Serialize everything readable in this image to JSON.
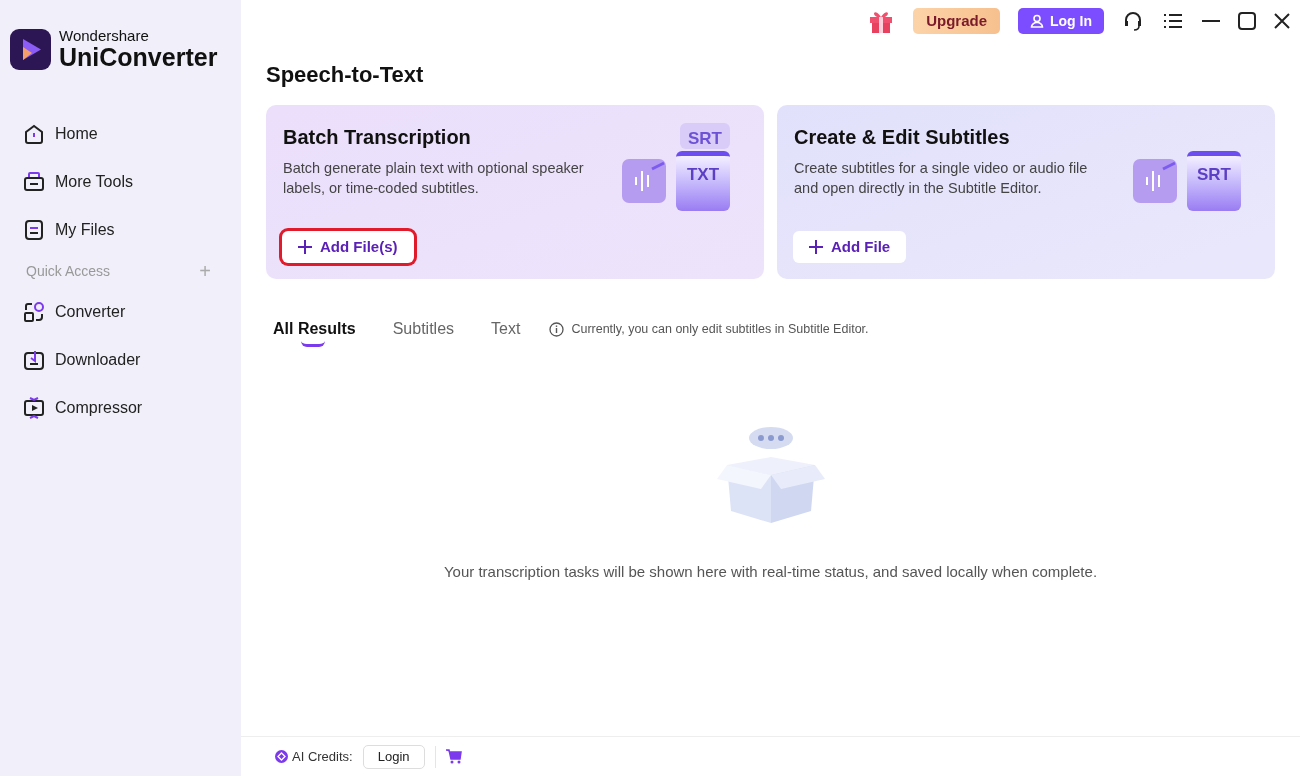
{
  "brand": {
    "maker": "Wondershare",
    "product": "UniConverter"
  },
  "sidebar": {
    "items": [
      {
        "label": "Home"
      },
      {
        "label": "More Tools"
      },
      {
        "label": "My Files"
      }
    ],
    "section": {
      "label": "Quick Access",
      "add": "+"
    },
    "quick_items": [
      {
        "label": "Converter"
      },
      {
        "label": "Downloader"
      },
      {
        "label": "Compressor"
      }
    ]
  },
  "topbar": {
    "upgrade": "Upgrade",
    "login": "Log In"
  },
  "page_title": "Speech-to-Text",
  "cards": [
    {
      "title": "Batch Transcription",
      "description": "Batch generate plain text with optional speaker labels, or time-coded subtitles.",
      "button": "Add File(s)",
      "highlighted": true,
      "art_labels": [
        "SRT",
        "TXT"
      ]
    },
    {
      "title": "Create & Edit Subtitles",
      "description": "Create subtitles for a single video or audio file and open directly in the Subtitle Editor.",
      "button": "Add File",
      "highlighted": false,
      "art_labels": [
        "SRT"
      ]
    }
  ],
  "tabs": [
    {
      "label": "All Results",
      "selected": true
    },
    {
      "label": "Subtitles",
      "selected": false
    },
    {
      "label": "Text",
      "selected": false
    }
  ],
  "notice": "Currently, you can only edit subtitles in Subtitle Editor.",
  "empty_message": "Your transcription tasks will be shown here with real-time status, and saved locally when complete.",
  "footer": {
    "credits_label": "AI Credits:",
    "login": "Login"
  }
}
